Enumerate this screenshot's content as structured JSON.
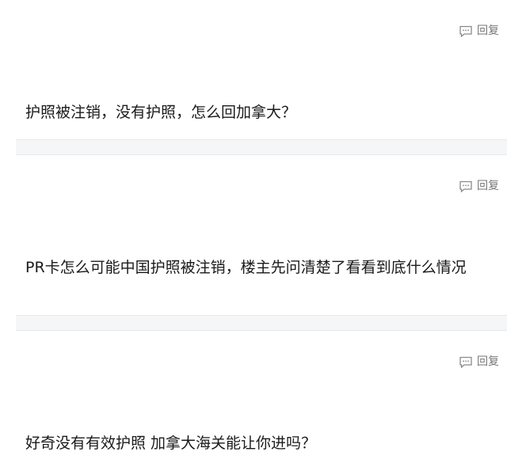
{
  "replies": [
    {
      "reply_label": "回复",
      "text": "护照被注销，没有护照，怎么回加拿大？"
    },
    {
      "reply_label": "回复",
      "text": "PR卡怎么可能中国护照被注销，楼主先问清楚了看看到底什么情况"
    },
    {
      "reply_label": "回复",
      "text": "好奇没有有效护照 加拿大海关能让你进吗？"
    }
  ],
  "icons": {
    "reply": "comment-bubble-icon"
  },
  "colors": {
    "text": "#1a1a1a",
    "muted": "#777777",
    "separator": "#f5f6f8"
  }
}
